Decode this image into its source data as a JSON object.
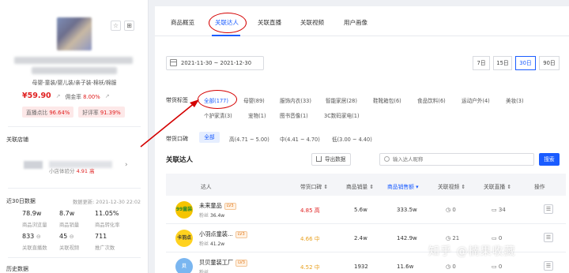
{
  "product": {
    "favorite_icon": "star-icon",
    "qr_icon": "qr-code-icon",
    "categories": "母婴-童装/婴儿装/亲子装-棉袄/棉服",
    "price": "¥59.90",
    "commission_label": "佣金率",
    "commission_rate": "8.00%",
    "conversion_label": "直播点比",
    "conversion_value": "96.64%",
    "good_review_label": "好评率",
    "good_review_value": "91.39%"
  },
  "store": {
    "section_title": "关联店铺",
    "experience_label": "小店体验分",
    "experience_score": "4.91",
    "experience_tag": "高"
  },
  "stats": {
    "section_title": "近30日数据",
    "update_text": "数据更新: 2021-12-30 22:02",
    "items": [
      {
        "value": "78.9w",
        "label": "商品浏览量"
      },
      {
        "value": "8.7w",
        "label": "商品销量"
      },
      {
        "value": "11.05%",
        "label": "商品转化率"
      },
      {
        "value": "833",
        "label": "关联直播数"
      },
      {
        "value": "45",
        "label": "关联视频"
      },
      {
        "value": "711",
        "label": "推广次数"
      }
    ],
    "next_section": "历史数据"
  },
  "tabs": [
    {
      "label": "商品概览",
      "active": false
    },
    {
      "label": "关联达人",
      "active": true
    },
    {
      "label": "关联直播",
      "active": false
    },
    {
      "label": "关联视频",
      "active": false
    },
    {
      "label": "用户画像",
      "active": false
    }
  ],
  "date_range": "2021-11-30  ~  2021-12-30",
  "periods": [
    {
      "label": "7日",
      "active": false
    },
    {
      "label": "15日",
      "active": false
    },
    {
      "label": "30日",
      "active": true
    },
    {
      "label": "90日",
      "active": false
    }
  ],
  "tag_filter": {
    "label": "带货标签",
    "row1": [
      "全部(177)",
      "母婴(89)",
      "服饰内衣(33)",
      "智能家居(28)",
      "鞋靴箱包(6)",
      "食品饮料(6)",
      "运动户外(4)",
      "美妆(3)"
    ],
    "row2": [
      "个护家清(3)",
      "宠物(1)",
      "图书音像(1)",
      "3C数码家电(1)"
    ]
  },
  "reputation_filter": {
    "label": "带货口碑",
    "options": [
      "全部",
      "高(4.71 ~ 5.00)",
      "中(4.41 ~ 4.70)",
      "低(3.00 ~ 4.40)"
    ]
  },
  "list": {
    "title": "关联达人",
    "export_label": "导出数据",
    "search_placeholder": "输入达人昵称",
    "search_button": "搜索",
    "columns": [
      "达人",
      "带货口碑",
      "商品销量",
      "商品销售额",
      "关联视频",
      "关联直播",
      "操作"
    ],
    "rows": [
      {
        "avatar_text": "99童装",
        "avatar_color": "#f5c400",
        "name": "未来童品",
        "level": "LV3",
        "fans_label": "粉丝",
        "fans": "36.4w",
        "score": "4.85 高",
        "score_color": "#e02020",
        "sales": "5.6w",
        "revenue": "333.5w",
        "videos": "0",
        "lives": "34"
      },
      {
        "avatar_text": "卡羽点",
        "avatar_color": "#ffd21f",
        "name": "小羽点童装...",
        "level": "LV3",
        "fans_label": "粉丝",
        "fans": "41.2w",
        "score": "4.66 中",
        "score_color": "#e8a020",
        "sales": "2.4w",
        "revenue": "142.9w",
        "videos": "21",
        "lives": "0"
      },
      {
        "avatar_text": "贝",
        "avatar_color": "#7ab6f0",
        "name": "贝贝童装工厂",
        "level": "LV3",
        "fans_label": "粉丝",
        "fans": "",
        "score": "4.52 中",
        "score_color": "#e8a020",
        "sales": "1932",
        "revenue": "11.6w",
        "videos": "0",
        "lives": "0"
      }
    ]
  },
  "watermark": "知乎 @楠果收藏",
  "colors": {
    "accent": "#1a5cff",
    "annotation": "#d40000",
    "price": "#e02020"
  }
}
